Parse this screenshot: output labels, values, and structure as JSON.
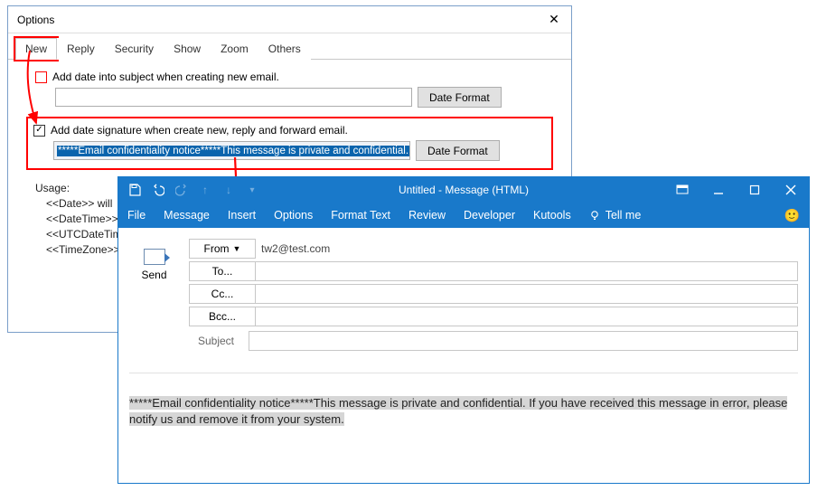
{
  "options": {
    "title": "Options",
    "tabs": [
      "New",
      "Reply",
      "Security",
      "Show",
      "Zoom",
      "Others"
    ],
    "active_tab": "New",
    "check1_label": "Add date into subject when creating new email.",
    "field1_value": "",
    "date_format_btn": "Date Format",
    "check2_label": "Add date signature when create new, reply and forward email.",
    "check2_checked": "✓",
    "sig_value": "*****Email confidentiality notice*****This message is private and confidential. If yo",
    "usage_label": "Usage:",
    "usage_lines": [
      "<<Date>> will",
      "<<DateTime>>",
      "<<UTCDateTim",
      "<<TimeZone>>"
    ]
  },
  "message": {
    "window_title": "Untitled  -  Message (HTML)",
    "ribbon_tabs": [
      "File",
      "Message",
      "Insert",
      "Options",
      "Format Text",
      "Review",
      "Developer",
      "Kutools"
    ],
    "tell_me": "Tell me",
    "from_label": "From",
    "from_value": "tw2@test.com",
    "to_label": "To...",
    "cc_label": "Cc...",
    "bcc_label": "Bcc...",
    "subject_label": "Subject",
    "send_label": "Send",
    "body_text": "*****Email confidentiality notice*****This message is private and confidential. If you have received this message in error, please notify us and remove it from your system."
  }
}
